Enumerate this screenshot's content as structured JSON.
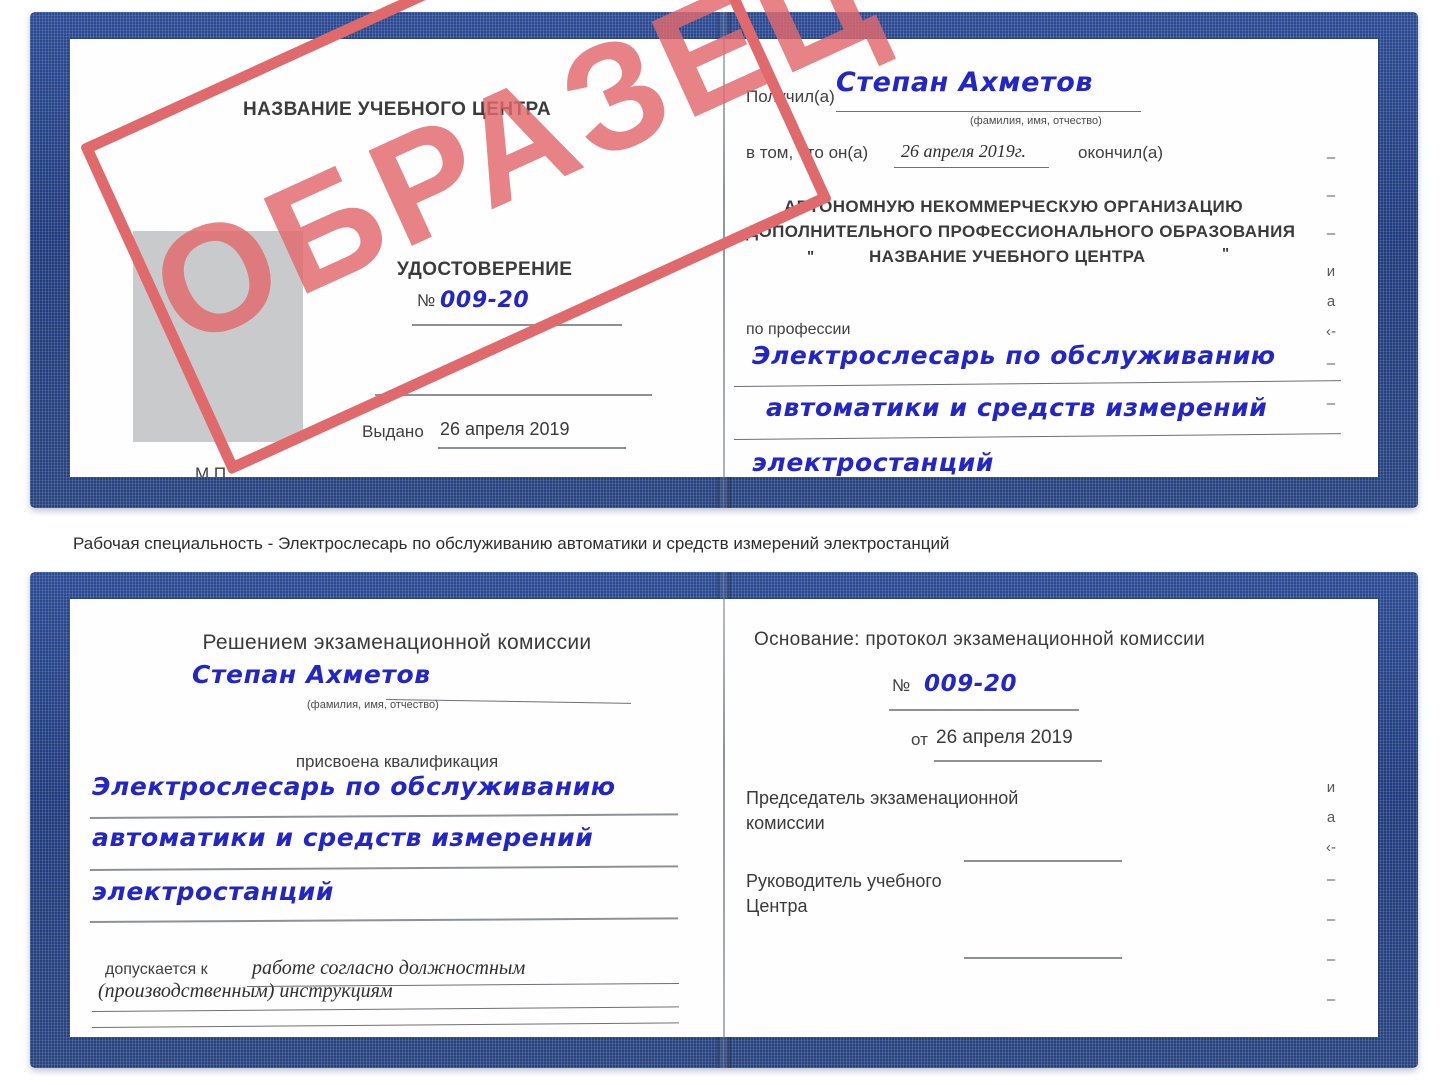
{
  "watermark": {
    "text": "ОБРАЗЕЦ",
    "color": "#e2696c"
  },
  "colors": {
    "cover_blue": "#26407f",
    "handwriting_blue": "#2226c8",
    "rule_gray": "#8d9196",
    "photo_gray": "#c9cacb",
    "stamp_red": "#e2696c"
  },
  "certificate_top": {
    "left_page": {
      "org_title": "НАЗВАНИЕ УЧЕБНОГО ЦЕНТРА",
      "doc_type": "УДОСТОВЕРЕНИЕ",
      "number_label": "№",
      "number_value": "009-20",
      "issued_label": "Выдано",
      "issued_value": "26 апреля 2019",
      "seal_label": "М.П.",
      "photo_placeholder": "photo-box"
    },
    "right_page": {
      "received_label": "Получил(а)",
      "received_value": "Степан Ахметов",
      "fio_hint": "(фамилия, имя, отчество)",
      "that_he_label": "в том, что он(а)",
      "date_value": "26 апреля 2019г.",
      "graduated_label": "окончил(а)",
      "org_line1": "АВТОНОМНУЮ НЕКОММЕРЧЕСКУЮ ОРГАНИЗАЦИЮ",
      "org_line2": "ДОПОЛНИТЕЛЬНОГО ПРОФЕССИОНАЛЬНОГО ОБРАЗОВАНИЯ",
      "org_quote_open": "\"",
      "org_line3": "НАЗВАНИЕ УЧЕБНОГО ЦЕНТРА",
      "org_quote_close": "\"",
      "profession_label": "по профессии",
      "profession_line1": "Электрослесарь по обслуживанию",
      "profession_line2": "автоматики и средств измерений",
      "profession_line3": "электростанций",
      "margin_glyphs": [
        "–",
        "–",
        "–",
        "и",
        "а",
        "‹-",
        "–",
        "–"
      ]
    }
  },
  "caption": "Рабочая специальность - Электрослесарь по обслуживанию автоматики и средств измерений электростанций",
  "certificate_bottom": {
    "left_page": {
      "decision_title": "Решением экзаменационной комиссии",
      "name_value": "Степан Ахметов",
      "fio_hint": "(фамилия, имя, отчество)",
      "qualification_label": "присвоена квалификация",
      "qualification_line1": "Электрослесарь по обслуживанию",
      "qualification_line2": "автоматики и средств измерений",
      "qualification_line3": "электростанций",
      "admitted_label": "допускается к",
      "admitted_line1": "работе согласно должностным",
      "admitted_line2": "(производственным) инструкциям"
    },
    "right_page": {
      "basis_label": "Основание: протокол экзаменационной комиссии",
      "number_label": "№",
      "number_value": "009-20",
      "date_label": "от",
      "date_value": "26 апреля 2019",
      "chairman_line1": "Председатель экзаменационной",
      "chairman_line2": "комиссии",
      "head_line1": "Руководитель учебного",
      "head_line2": "Центра",
      "margin_glyphs": [
        "и",
        "а",
        "‹-",
        "–",
        "–",
        "–",
        "–",
        "–"
      ]
    }
  }
}
